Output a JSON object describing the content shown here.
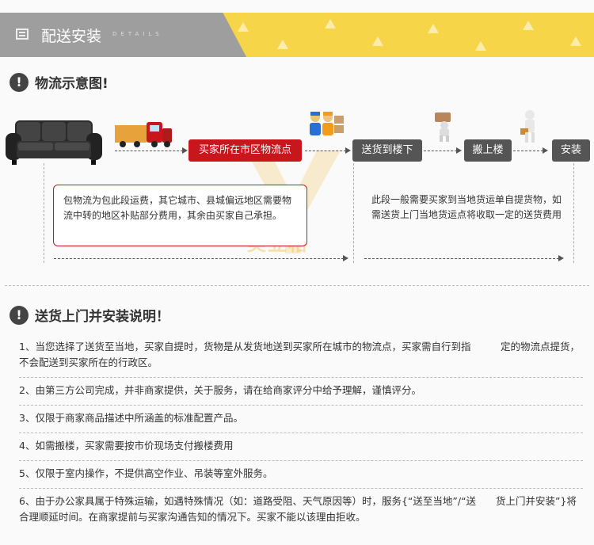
{
  "banner": {
    "title": "配送安装",
    "subtitle": "DETAILS"
  },
  "logistics": {
    "heading": "物流示意图!",
    "steps": {
      "city_point": "买家所在市区物流点",
      "downstairs": "送货到楼下",
      "upstairs": "搬上楼",
      "install": "安装"
    },
    "note_left": "包物流为包此段运费，其它城市、县城偏远地区需要物流中转的地区补贴部分费用，其余由买家自己承担。",
    "note_right": "此段一般需要买家到当地货运单自提货物，如需送货上门当地货运点将收取一定的送货费用",
    "watermark": "美立格"
  },
  "install": {
    "heading": "送货上门并安装说明！",
    "items": [
      "1、当您选择了送货至当地，买家自提时，货物是从发货地送到买家所在城市的物流点，买家需自行到指　　　定的物流点提货，不会配送到买家所在的行政区。",
      "2、由第三方公司完成，并非商家提供，关于服务，请在给商家评分中给予理解，谨慎评分。",
      "3、仅限于商家商品描述中所涵盖的标准配置产品。",
      "4、如需搬楼，买家需要按市价现场支付搬楼费用",
      "5、仅限于室内操作，不提供高空作业、吊装等室外服务。",
      "6、由于办公家具属于特殊运输，如遇特殊情况（如：道路受阻、天气原因等）时，服务{“送至当地”/“送　　货上门并安装”}将合理顺延时间。在商家提前与买家沟通告知的情况下。买家不能以该理由拒收。"
    ]
  },
  "colors": {
    "accent_red": "#c8161d",
    "banner_gray": "#9e9e9e",
    "banner_yellow": "#f7d548",
    "step_gray": "#555555"
  },
  "icons": [
    "details-list-icon",
    "exclamation-icon",
    "sofa-icon",
    "truck-icon",
    "delivery-workers-icon",
    "carrying-box-icon",
    "installing-worker-icon"
  ]
}
